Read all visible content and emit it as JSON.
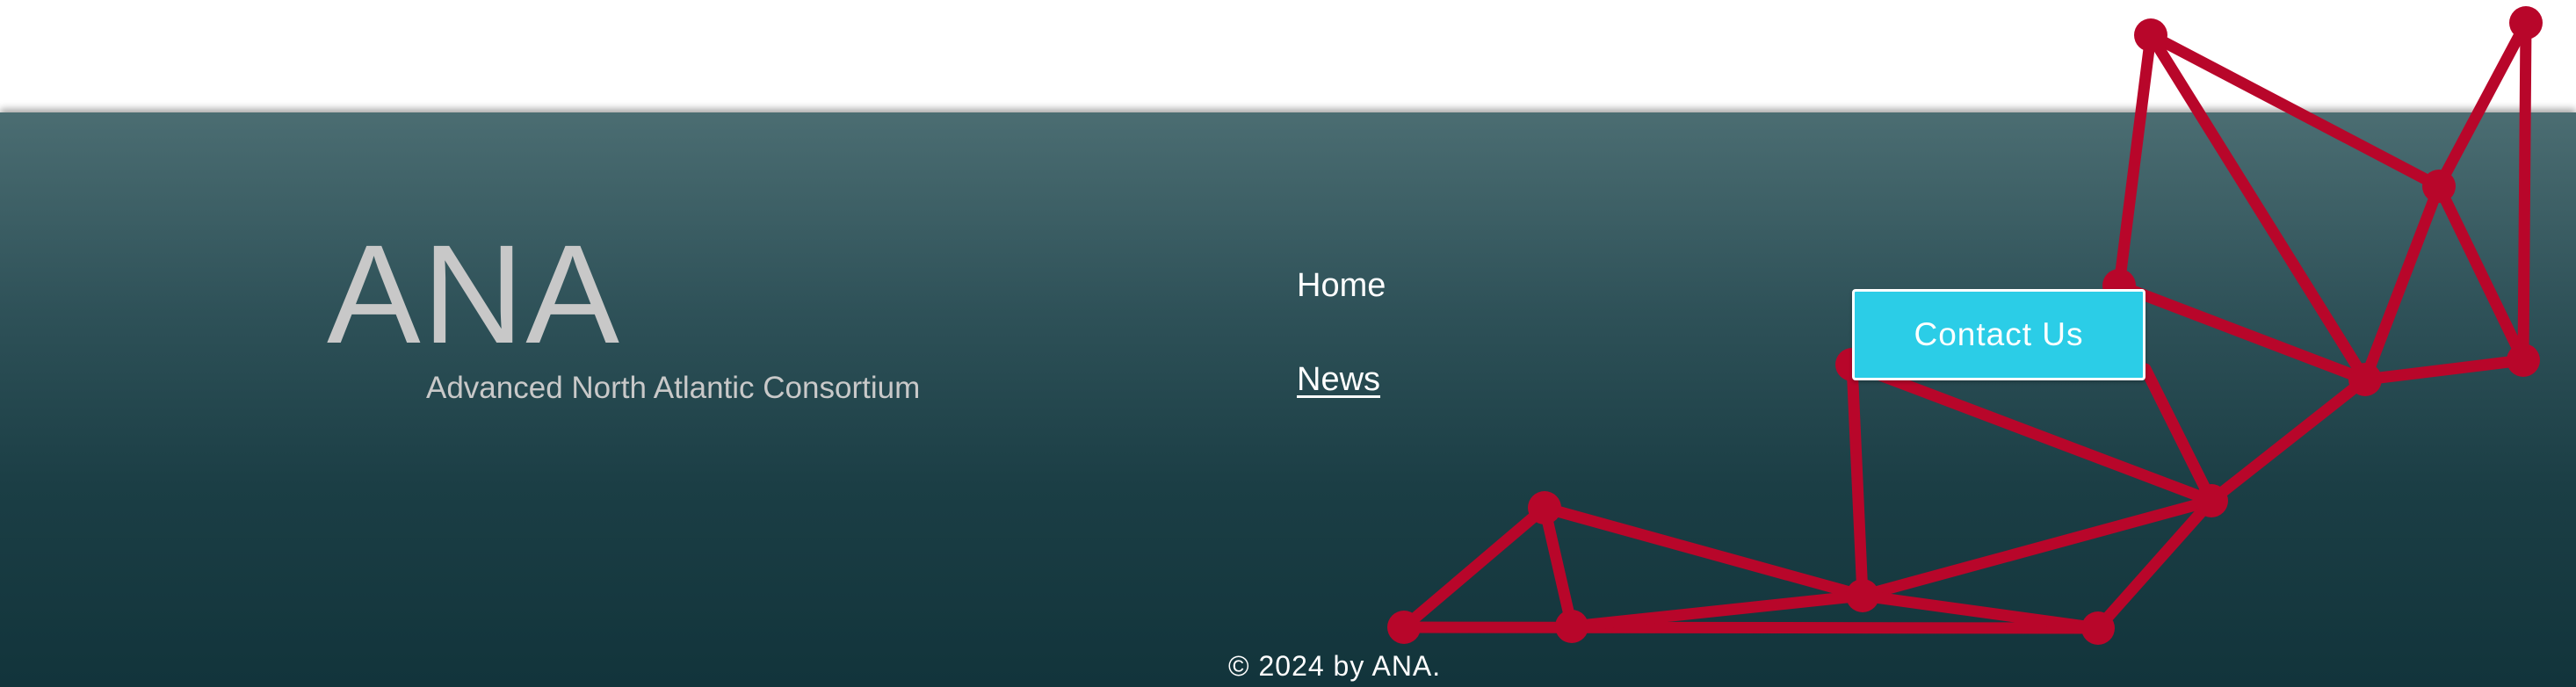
{
  "brand": {
    "title": "ANA",
    "tagline": "Advanced North Atlantic Consortium"
  },
  "nav": {
    "items": [
      {
        "label": "Home",
        "active": false
      },
      {
        "label": "News",
        "active": true
      }
    ]
  },
  "cta": {
    "label": "Contact Us",
    "color": "#2bcde7"
  },
  "footer": {
    "copyright": "© 2024 by ANA."
  },
  "decoration": {
    "name": "red-network-graphic",
    "color": "#b8062a"
  },
  "colors": {
    "band_top": "#4b6d72",
    "band_bottom": "#12343b",
    "page_background": "#ffffff"
  }
}
